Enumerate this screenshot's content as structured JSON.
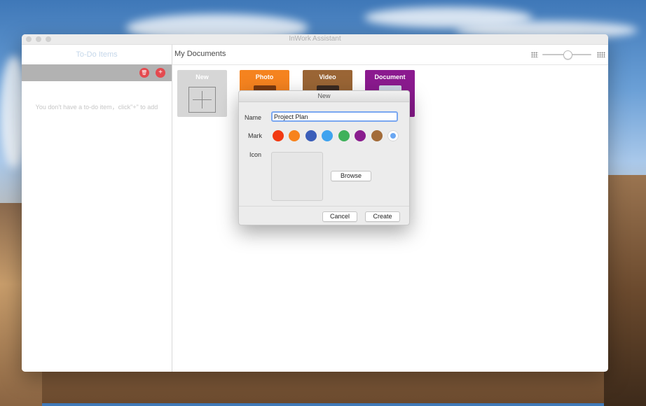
{
  "window": {
    "title": "InWork Assistant"
  },
  "sidebar": {
    "title": "To-Do Items",
    "empty_message": "You don't have a to-do item，click\"+\" to add",
    "delete_icon_glyph": "🗑",
    "add_icon_glyph": "+"
  },
  "main": {
    "title": "My Documents",
    "zoom_level": 0.45,
    "tiles": [
      {
        "label": "New",
        "color": "#d6d6d6"
      },
      {
        "label": "Photo",
        "color": "#f5831f"
      },
      {
        "label": "Video",
        "color": "#9a6535"
      },
      {
        "label": "Document",
        "color": "#8b1a8f"
      }
    ]
  },
  "dialog": {
    "title": "New",
    "name_label": "Name",
    "name_value": "Project Plan",
    "mark_label": "Mark",
    "mark_colors": [
      "#f23a12",
      "#f7831d",
      "#3b5eb9",
      "#3fa3ef",
      "#3fb15b",
      "#8a1d8e",
      "#a36c3a",
      "#6aa7f2"
    ],
    "selected_mark_index": 7,
    "icon_label": "Icon",
    "browse_label": "Browse",
    "cancel_label": "Cancel",
    "create_label": "Create"
  }
}
